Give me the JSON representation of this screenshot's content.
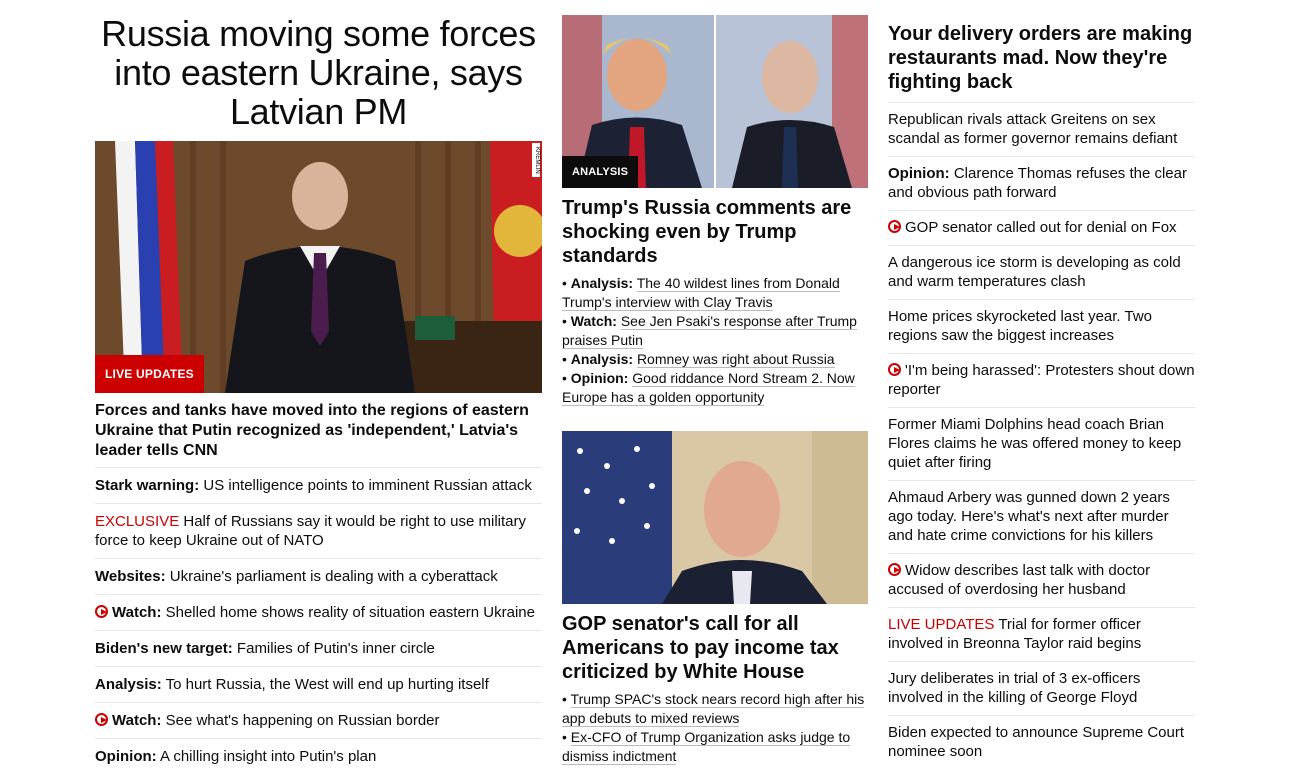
{
  "lead": {
    "title": "Russia moving some forces into eastern Ukraine, says Latvian PM",
    "badge": "LIVE UPDATES",
    "image_tag": "KREMLIN",
    "description": "Forces and tanks have moved into the regions of eastern Ukraine that Putin recognized as 'independent,' Latvia's leader tells CNN",
    "items": [
      {
        "label": "Stark warning:",
        "text": " US intelligence points to imminent Russian attack",
        "video": false,
        "red": false
      },
      {
        "label": "EXCLUSIVE",
        "text": " Half of Russians say it would be right to use military force to keep Ukraine out of NATO",
        "video": false,
        "red": true
      },
      {
        "label": "Websites:",
        "text": " Ukraine's parliament is dealing with a cyberattack",
        "video": false,
        "red": false
      },
      {
        "label": "Watch:",
        "text": " Shelled home shows reality of situation eastern Ukraine",
        "video": true,
        "red": false
      },
      {
        "label": "Biden's new target:",
        "text": " Families of Putin's inner circle",
        "video": false,
        "red": false
      },
      {
        "label": "Analysis:",
        "text": " To hurt Russia, the West will end up hurting itself",
        "video": false,
        "red": false
      },
      {
        "label": "Watch:",
        "text": " See what's happening on Russian border",
        "video": true,
        "red": false
      },
      {
        "label": "Opinion:",
        "text": " A chilling insight into Putin's plan",
        "video": false,
        "red": false
      }
    ]
  },
  "middle": {
    "card1": {
      "badge": "ANALYSIS",
      "title": "Trump's Russia comments are shocking even by Trump standards",
      "items": [
        {
          "label": "Analysis:",
          "text": "The 40 wildest lines from Donald Trump's interview with Clay Travis"
        },
        {
          "label": "Watch:",
          "text": "See Jen Psaki's response after Trump praises Putin"
        },
        {
          "label": "Analysis:",
          "text": "Romney was right about Russia"
        },
        {
          "label": "Opinion:",
          "text": "Good riddance Nord Stream 2. Now Europe has a golden opportunity"
        }
      ]
    },
    "card2": {
      "title": "GOP senator's call for all Americans to pay income tax criticized by White House",
      "items": [
        {
          "text": "Trump SPAC's stock nears record high after his app debuts to mixed reviews"
        },
        {
          "text": "Ex-CFO of Trump Organization asks judge to dismiss indictment"
        }
      ]
    }
  },
  "right": {
    "title": "Your delivery orders are making restaurants mad. Now they're fighting back",
    "items": [
      {
        "label": "",
        "text": "Republican rivals attack Greitens on sex scandal as former governor remains defiant",
        "video": false
      },
      {
        "label": "Opinion:",
        "text": " Clarence Thomas refuses the clear and obvious path forward",
        "video": false
      },
      {
        "label": "",
        "text": "GOP senator called out for denial on Fox",
        "video": true
      },
      {
        "label": "",
        "text": "A dangerous ice storm is developing as cold and warm temperatures clash",
        "video": false
      },
      {
        "label": "",
        "text": "Home prices skyrocketed last year. Two regions saw the biggest increases",
        "video": false
      },
      {
        "label": "",
        "text": "'I'm being harassed': Protesters shout down reporter",
        "video": true
      },
      {
        "label": "",
        "text": "Former Miami Dolphins head coach Brian Flores claims he was offered money to keep quiet after firing",
        "video": false
      },
      {
        "label": "",
        "text": "Ahmaud Arbery was gunned down 2 years ago today. Here's what's next after murder and hate crime convictions for his killers",
        "video": false
      },
      {
        "label": "",
        "text": "Widow describes last talk with doctor accused of overdosing her husband",
        "video": true
      },
      {
        "label": "LIVE UPDATES",
        "text": " Trial for former officer involved in Breonna Taylor raid begins",
        "video": false,
        "red": true
      },
      {
        "label": "",
        "text": "Jury deliberates in trial of 3 ex-officers involved in the killing of George Floyd",
        "video": false
      },
      {
        "label": "",
        "text": "Biden expected to announce Supreme Court nominee soon",
        "video": false
      }
    ]
  },
  "colors": {
    "accent_red": "#cc0000",
    "text": "#0c0c0c",
    "divider": "#e6e6e6"
  }
}
